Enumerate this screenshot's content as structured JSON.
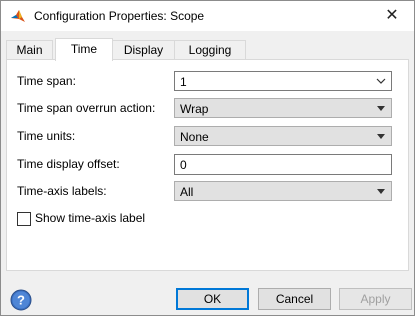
{
  "window": {
    "title": "Configuration Properties: Scope",
    "close_glyph": "✕"
  },
  "tabs": [
    {
      "label": "Main",
      "active": false
    },
    {
      "label": "Time",
      "active": true
    },
    {
      "label": "Display",
      "active": false
    },
    {
      "label": "Logging",
      "active": false
    }
  ],
  "time": {
    "span": {
      "label": "Time span:",
      "value": "1"
    },
    "overrun": {
      "label": "Time span overrun action:",
      "value": "Wrap"
    },
    "units": {
      "label": "Time units:",
      "value": "None"
    },
    "offset": {
      "label": "Time display offset:",
      "value": "0"
    },
    "axis_labels": {
      "label": "Time-axis labels:",
      "value": "All"
    },
    "show_axis_label": {
      "label": "Show time-axis label",
      "checked": false
    }
  },
  "buttons": {
    "ok": "OK",
    "cancel": "Cancel",
    "apply": "Apply"
  },
  "icons": {
    "app": "matlab-logo-icon",
    "help": "help-icon"
  }
}
